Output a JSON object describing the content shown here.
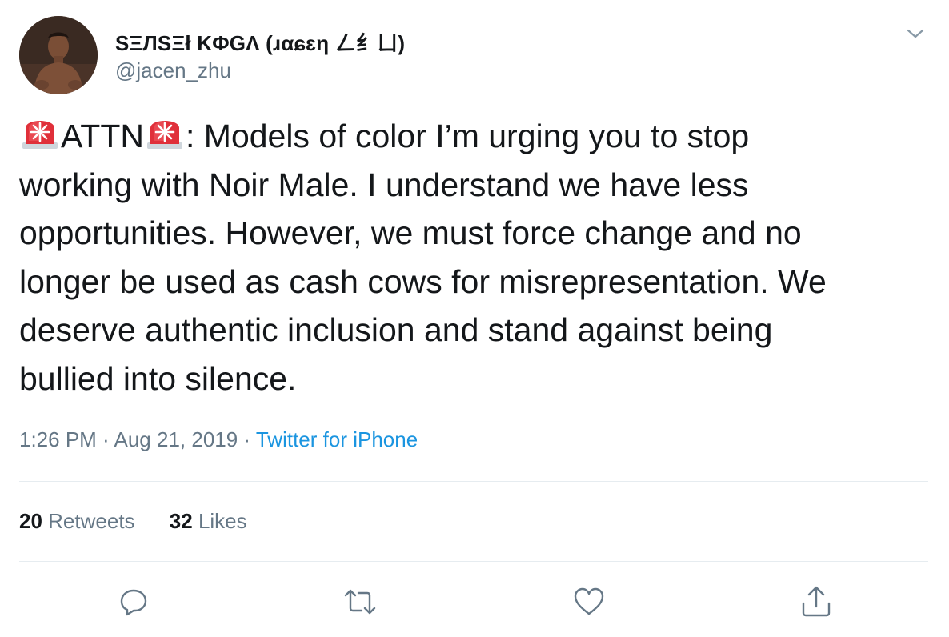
{
  "user": {
    "display_name": "SΞЛSΞł KΦGΛ (ɹαɕɛη ㄥ纟ㄩ)",
    "handle": "@jacen_zhu"
  },
  "tweet": {
    "lines": [
      {
        "pre_emoji": true,
        "before": "ATTN",
        "post_emoji": true,
        "after": ": Models of color I’m urging you to stop"
      },
      {
        "text": "working with Noir Male. I understand we have less"
      },
      {
        "text": "opportunities. However, we must force change and no"
      },
      {
        "text": "longer be used as cash cows for misrepresentation. We"
      },
      {
        "text": "deserve authentic inclusion and stand against being"
      },
      {
        "text": "bullied into silence."
      }
    ],
    "emoji_name": "police-car-light-emoji"
  },
  "meta": {
    "time": "1:26 PM",
    "sep1": " · ",
    "date": "Aug 21, 2019",
    "sep2": " · ",
    "source": "Twitter for iPhone"
  },
  "stats": {
    "retweets_count": "20",
    "retweets_label": "Retweets",
    "likes_count": "32",
    "likes_label": "Likes"
  },
  "actions": {
    "reply_icon": "reply-icon",
    "retweet_icon": "retweet-icon",
    "like_icon": "heart-icon",
    "share_icon": "share-icon"
  },
  "colors": {
    "text": "#14171a",
    "secondary": "#657786",
    "link": "#1b95e0",
    "divider": "#e6ecf0",
    "siren_red": "#e0303a"
  }
}
